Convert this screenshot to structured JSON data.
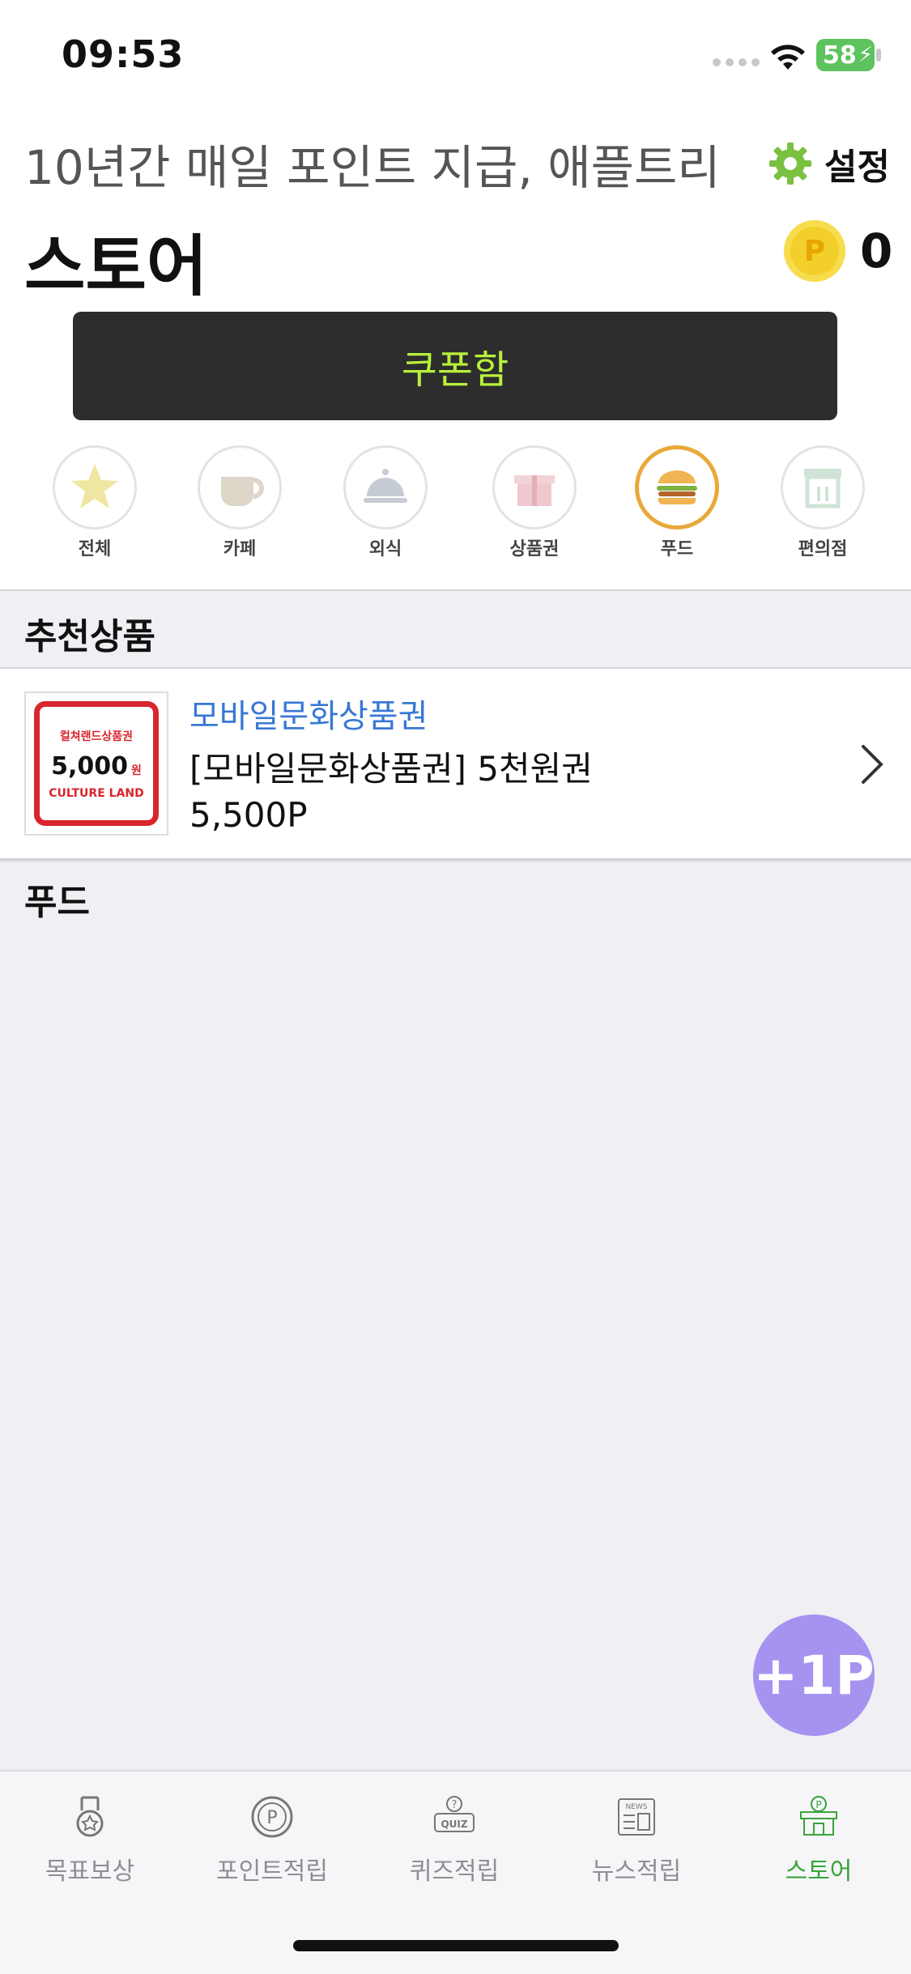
{
  "status": {
    "time": "09:53",
    "battery": "58"
  },
  "header": {
    "tagline": "10년간 매일 포인트 지급, 애플트리",
    "settings_label": "설정",
    "title": "스토어",
    "points": "0",
    "coin_letter": "P"
  },
  "coupon_button": "쿠폰함",
  "categories": [
    {
      "label": "전체",
      "icon": "star-icon"
    },
    {
      "label": "카페",
      "icon": "coffee-cup-icon"
    },
    {
      "label": "외식",
      "icon": "food-cloche-icon"
    },
    {
      "label": "상품권",
      "icon": "gift-box-icon"
    },
    {
      "label": "푸드",
      "icon": "burger-icon",
      "active": true
    },
    {
      "label": "편의점",
      "icon": "convenience-store-icon"
    }
  ],
  "recommended": {
    "heading": "추천상품",
    "item": {
      "category": "모바일문화상품권",
      "name": "[모바일문화상품권] 5천원권",
      "price": "5,500P",
      "thumb_brand": "컬쳐랜드상품권",
      "thumb_amount": "5,000",
      "thumb_unit": "원",
      "thumb_footer": "CULTURE LAND"
    }
  },
  "food_section": {
    "heading": "푸드"
  },
  "fab_label": "+1P",
  "tabs": [
    {
      "label": "목표보상",
      "icon": "medal-icon"
    },
    {
      "label": "포인트적립",
      "icon": "point-coin-icon"
    },
    {
      "label": "퀴즈적립",
      "icon": "quiz-icon"
    },
    {
      "label": "뉴스적립",
      "icon": "news-icon"
    },
    {
      "label": "스토어",
      "icon": "store-icon",
      "active": true
    }
  ],
  "colors": {
    "accent_green": "#38a53a",
    "coupon_text": "#b8f03c",
    "link_blue": "#3878d4",
    "fab": "#a693f0",
    "active_category": "#e8a93a"
  }
}
